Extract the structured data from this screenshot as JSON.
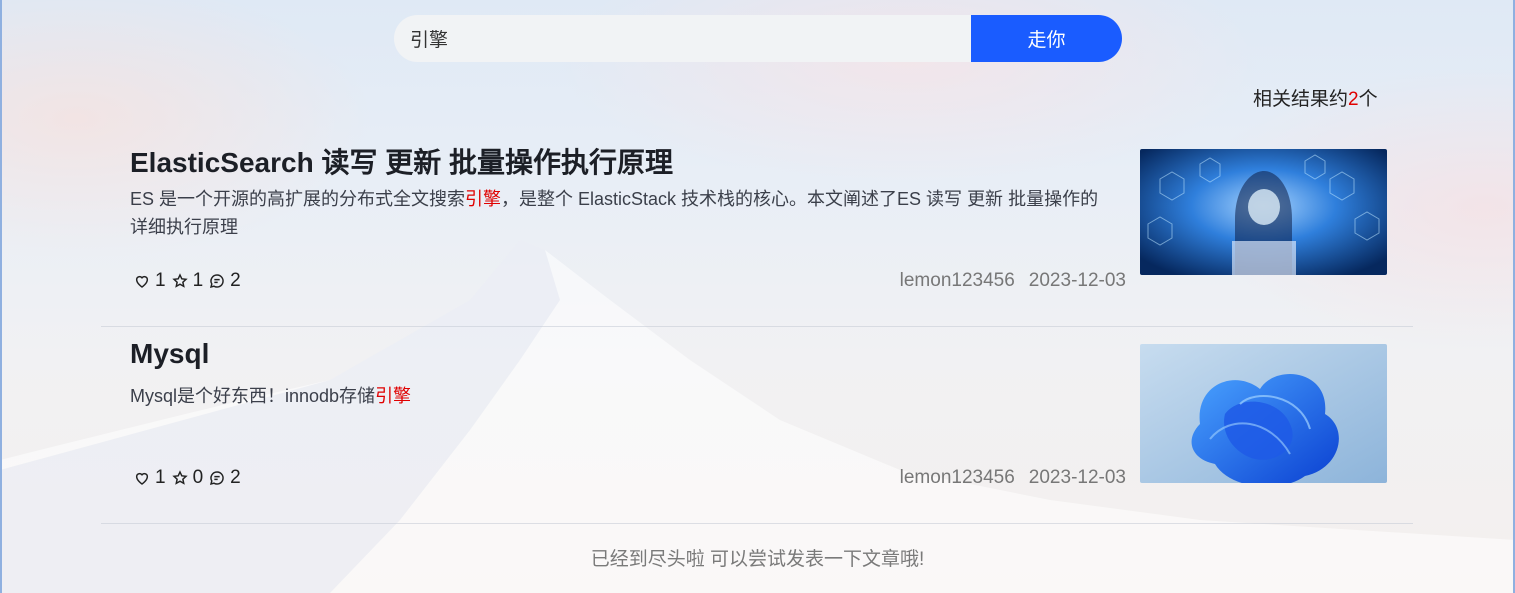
{
  "search": {
    "value": "引擎",
    "button_label": "走你"
  },
  "result_summary": {
    "prefix": "相关结果约",
    "count": "2",
    "suffix": "个"
  },
  "articles": [
    {
      "title": "ElasticSearch 读写 更新 批量操作执行原理",
      "desc_before": "ES 是一个开源的高扩展的分布式全文搜索",
      "desc_highlight": "引擎",
      "desc_after": "，是整个 ElasticStack 技术栈的核心。本文阐述了ES 读写 更新 批量操作的详细执行原理",
      "likes": "1",
      "favorites": "1",
      "comments": "2",
      "author": "lemon123456",
      "date": "2023-12-03",
      "thumbnail": "cyber-hacker-image"
    },
    {
      "title": "Mysql",
      "desc_before": "Mysql是个好东西！innodb存储",
      "desc_highlight": "引擎",
      "desc_after": "",
      "likes": "1",
      "favorites": "0",
      "comments": "2",
      "author": "lemon123456",
      "date": "2023-12-03",
      "thumbnail": "windows-bloom-image"
    }
  ],
  "footer_note": "已经到尽头啦 可以尝试发表一下文章哦!",
  "colors": {
    "accent": "#1a5cff",
    "highlight": "#e00000"
  }
}
